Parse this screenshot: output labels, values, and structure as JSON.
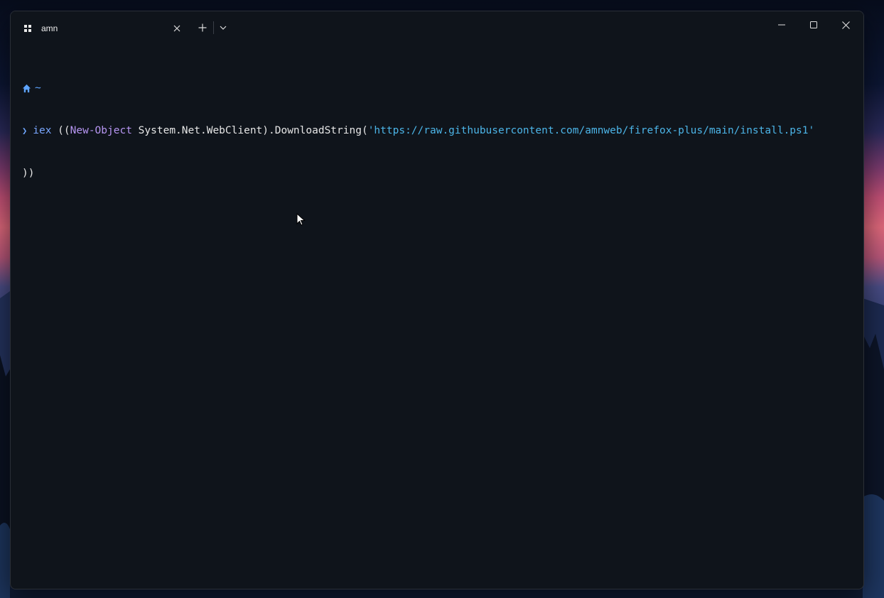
{
  "window": {
    "tab": {
      "title": "amn",
      "icon": "windows-icon",
      "close_symbol": "✕"
    },
    "new_tab_symbol": "+",
    "dropdown_icon": "chevron-down-icon",
    "controls": {
      "minimize_icon": "minimize-icon",
      "maximize_icon": "maximize-icon",
      "close_icon": "close-icon"
    }
  },
  "terminal": {
    "path": "~",
    "prompt_symbol": "❯",
    "command": {
      "cmd": "iex",
      "open_parens": " ((",
      "new_object": "New-Object",
      "middle": " System.Net.WebClient).DownloadString(",
      "url": "'https://raw.githubusercontent.com/amnweb/firefox-plus/main/install.ps1'",
      "continuation": "))"
    }
  },
  "colors": {
    "terminal_bg": "#0f141b",
    "keyword": "#7aa7ff",
    "type": "#b796f2",
    "string": "#4cb5e8",
    "prompt": "#6fa6ff"
  }
}
